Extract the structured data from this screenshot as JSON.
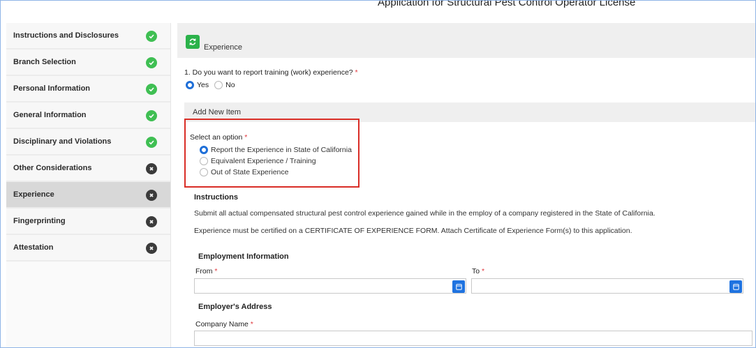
{
  "header": {
    "title": "Application for Structural Pest Control Operator License"
  },
  "sidebar": {
    "items": [
      {
        "label": "Instructions and Disclosures",
        "status": "complete",
        "icon": "check-circle-icon"
      },
      {
        "label": "Branch Selection",
        "status": "complete",
        "icon": "check-circle-icon"
      },
      {
        "label": "Personal Information",
        "status": "complete",
        "icon": "check-circle-icon"
      },
      {
        "label": "General Information",
        "status": "complete",
        "icon": "check-circle-icon"
      },
      {
        "label": "Disciplinary and Violations",
        "status": "complete",
        "icon": "check-circle-icon"
      },
      {
        "label": "Other Considerations",
        "status": "incomplete",
        "icon": "x-circle-icon"
      },
      {
        "label": "Experience",
        "status": "incomplete",
        "icon": "x-circle-icon",
        "active": true
      },
      {
        "label": "Fingerprinting",
        "status": "incomplete",
        "icon": "x-circle-icon"
      },
      {
        "label": "Attestation",
        "status": "incomplete",
        "icon": "x-circle-icon"
      }
    ]
  },
  "section": {
    "title": "Experience",
    "refresh_icon": "refresh-icon"
  },
  "question1": {
    "text": "1. Do you want to report training (work) experience?",
    "required_mark": "*",
    "options": [
      {
        "label": "Yes",
        "selected": true
      },
      {
        "label": "No",
        "selected": false
      }
    ]
  },
  "add_item": {
    "label": "Add New Item"
  },
  "select_option": {
    "label": "Select an option",
    "required_mark": "*",
    "options": [
      {
        "label": "Report the Experience in State of California",
        "selected": true
      },
      {
        "label": "Equivalent Experience / Training",
        "selected": false
      },
      {
        "label": "Out of State Experience",
        "selected": false
      }
    ]
  },
  "instructions": {
    "heading": "Instructions",
    "p1": "Submit all actual compensated structural pest control experience gained while in the employ of a company registered in the State of California.",
    "p2": "Experience must be certified on a CERTIFICATE OF EXPERIENCE FORM. Attach Certificate of Experience Form(s) to this application."
  },
  "employment": {
    "heading": "Employment Information",
    "from_label": "From",
    "to_label": "To",
    "required_mark": "*",
    "from_value": "",
    "to_value": ""
  },
  "address": {
    "heading": "Employer's Address",
    "company_label": "Company Name",
    "required_mark": "*",
    "company_value": ""
  },
  "colors": {
    "accent": "#1f73e0",
    "success": "#3fbf53",
    "incomplete": "#3b3b3b",
    "highlight_box": "#d92d26"
  }
}
